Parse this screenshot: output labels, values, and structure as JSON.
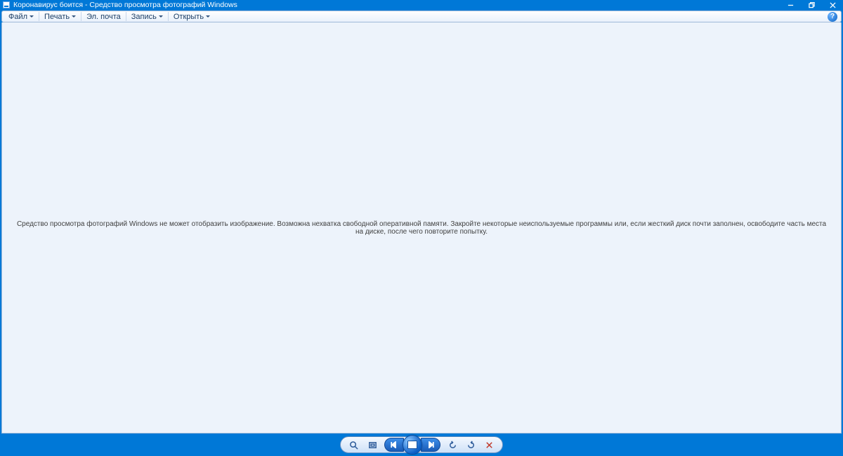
{
  "title_bar": {
    "title": "Коронавирус боится - Средство просмотра фотографий Windows"
  },
  "menu": {
    "file": "Файл",
    "print": "Печать",
    "email": "Эл. почта",
    "burn": "Запись",
    "open": "Открыть",
    "help_symbol": "?"
  },
  "content": {
    "error_message": "Средство просмотра фотографий Windows не может отобразить изображение. Возможна нехватка свободной оперативной памяти. Закройте некоторые неиспользуемые программы или, если жесткий диск почти заполнен, освободите часть места на диске, после чего повторите попытку."
  },
  "toolbar": {
    "zoom_label": "zoom",
    "actual_size_label": "actual-size",
    "previous_label": "previous",
    "slideshow_label": "slideshow",
    "next_label": "next",
    "rotate_ccw_label": "rotate-ccw",
    "rotate_cw_label": "rotate-cw",
    "delete_label": "delete"
  }
}
